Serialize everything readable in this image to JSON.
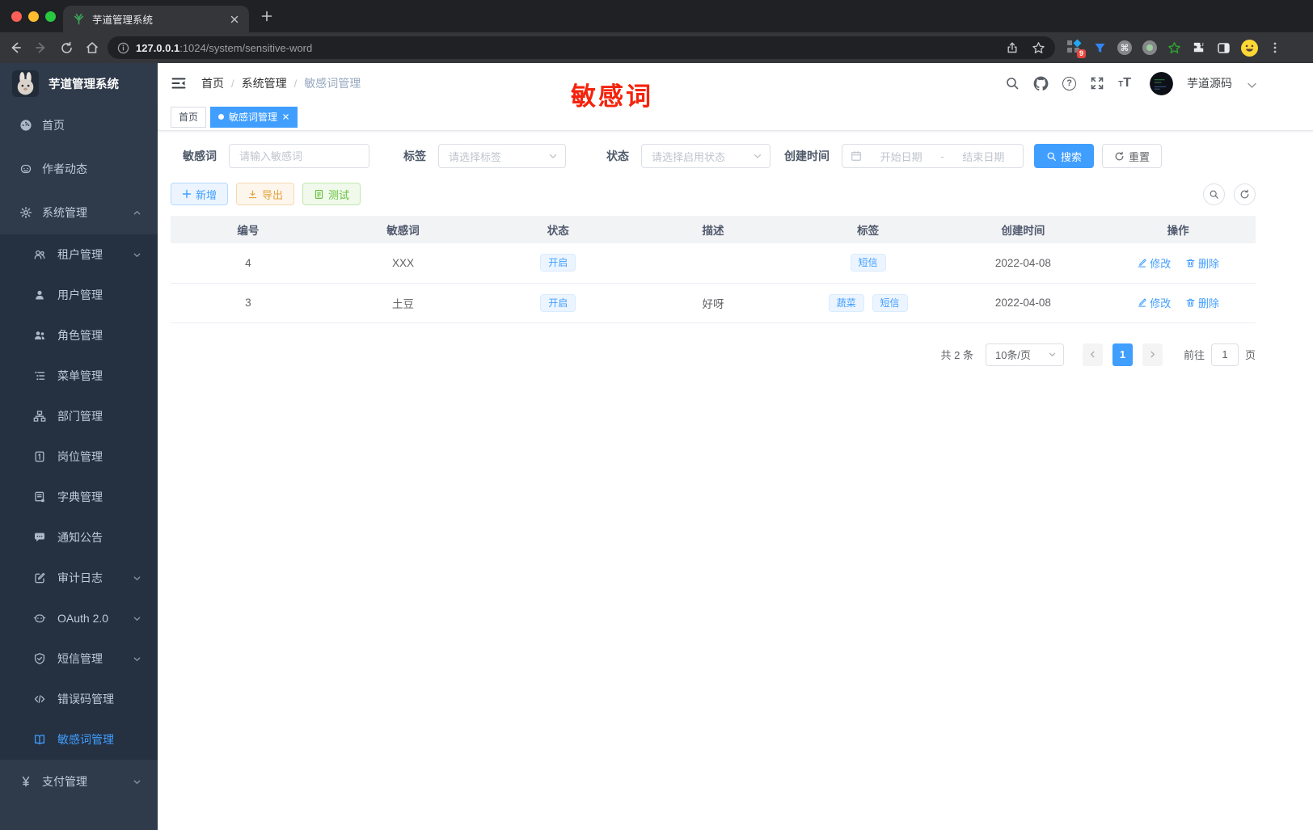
{
  "browser": {
    "tab_title": "芋道管理系统",
    "url_host": "127.0.0.1",
    "url_path": ":1024/system/sensitive-word",
    "ext_badge": "9",
    "glyphs": {
      "command": "⌘"
    }
  },
  "annotation": {
    "text": "敏感词"
  },
  "sidebar": {
    "app_title": "芋道管理系统",
    "items": [
      {
        "label": "首页"
      },
      {
        "label": "作者动态"
      },
      {
        "label": "系统管理"
      },
      {
        "label": "租户管理"
      },
      {
        "label": "用户管理"
      },
      {
        "label": "角色管理"
      },
      {
        "label": "菜单管理"
      },
      {
        "label": "部门管理"
      },
      {
        "label": "岗位管理"
      },
      {
        "label": "字典管理"
      },
      {
        "label": "通知公告"
      },
      {
        "label": "审计日志"
      },
      {
        "label": "OAuth 2.0"
      },
      {
        "label": "短信管理"
      },
      {
        "label": "错误码管理"
      },
      {
        "label": "敏感词管理"
      },
      {
        "label": "支付管理"
      }
    ]
  },
  "navbar": {
    "breadcrumb": [
      "首页",
      "系统管理",
      "敏感词管理"
    ],
    "separator": "/",
    "help_glyph": "?",
    "font_small": "T",
    "font_big": "T",
    "user": "芋道源码"
  },
  "tagsbar": {
    "home": "首页",
    "active": "敏感词管理"
  },
  "filters": {
    "keyword": {
      "label": "敏感词",
      "placeholder": "请输入敏感词"
    },
    "tag": {
      "label": "标签",
      "placeholder": "请选择标签"
    },
    "status": {
      "label": "状态",
      "placeholder": "请选择启用状态"
    },
    "create_time": {
      "label": "创建时间",
      "start": "开始日期",
      "separator": "-",
      "end": "结束日期"
    },
    "search": "搜索",
    "reset": "重置"
  },
  "toolbar": {
    "add": "新增",
    "export": "导出",
    "test": "测试"
  },
  "table": {
    "columns": [
      "编号",
      "敏感词",
      "状态",
      "描述",
      "标签",
      "创建时间",
      "操作"
    ],
    "actions": {
      "edit": "修改",
      "delete": "删除"
    },
    "rows": [
      {
        "id": "4",
        "word": "XXX",
        "status": "开启",
        "desc": "",
        "tags": [
          "短信"
        ],
        "created": "2022-04-08"
      },
      {
        "id": "3",
        "word": "土豆",
        "status": "开启",
        "desc": "好呀",
        "tags": [
          "蔬菜",
          "短信"
        ],
        "created": "2022-04-08"
      }
    ]
  },
  "pagination": {
    "total": "共 2 条",
    "page_size": "10条/页",
    "current": "1",
    "goto_label": "前往",
    "goto_value": "1",
    "unit": "页"
  },
  "colors": {
    "primary": "#409eff",
    "warning": "#e6a23c",
    "success": "#67c23a",
    "annotation": "#f5230c"
  }
}
